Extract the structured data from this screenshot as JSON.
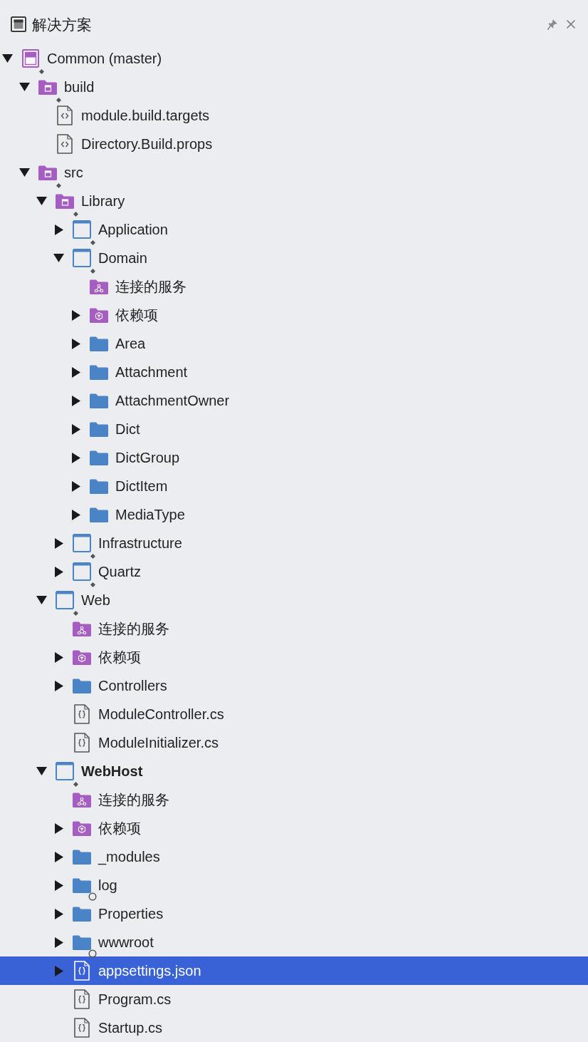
{
  "panel": {
    "title": "解决方案"
  },
  "tree": [
    {
      "label": "Common (master)",
      "kind": "solution",
      "marker": {
        "kind": "diamond"
      },
      "expanded": true,
      "selected": false,
      "children": [
        {
          "label": "build",
          "kind": "solution-folder",
          "marker": {
            "kind": "diamond"
          },
          "expanded": true,
          "selected": false,
          "children": [
            {
              "label": "module.build.targets",
              "kind": "code-file",
              "selected": false
            },
            {
              "label": "Directory.Build.props",
              "kind": "code-file",
              "selected": false
            }
          ]
        },
        {
          "label": "src",
          "kind": "solution-folder",
          "marker": {
            "kind": "diamond"
          },
          "expanded": true,
          "selected": false,
          "children": [
            {
              "label": "Library",
              "kind": "solution-folder",
              "marker": {
                "kind": "diamond"
              },
              "expanded": true,
              "selected": false,
              "children": [
                {
                  "label": "Application",
                  "kind": "project",
                  "marker": {
                    "kind": "diamond"
                  },
                  "expanded": false,
                  "selected": false,
                  "startup": false
                },
                {
                  "label": "Domain",
                  "kind": "project",
                  "marker": {
                    "kind": "diamond"
                  },
                  "expanded": true,
                  "selected": false,
                  "startup": false,
                  "children": [
                    {
                      "label": "连接的服务",
                      "kind": "services",
                      "selected": false
                    },
                    {
                      "label": "依赖项",
                      "kind": "dependencies",
                      "expanded": false,
                      "selected": false
                    },
                    {
                      "label": "Area",
                      "kind": "folder",
                      "expanded": false,
                      "selected": false
                    },
                    {
                      "label": "Attachment",
                      "kind": "folder",
                      "expanded": false,
                      "selected": false
                    },
                    {
                      "label": "AttachmentOwner",
                      "kind": "folder",
                      "expanded": false,
                      "selected": false
                    },
                    {
                      "label": "Dict",
                      "kind": "folder",
                      "expanded": false,
                      "selected": false
                    },
                    {
                      "label": "DictGroup",
                      "kind": "folder",
                      "expanded": false,
                      "selected": false
                    },
                    {
                      "label": "DictItem",
                      "kind": "folder",
                      "expanded": false,
                      "selected": false
                    },
                    {
                      "label": "MediaType",
                      "kind": "folder",
                      "expanded": false,
                      "selected": false
                    }
                  ]
                },
                {
                  "label": "Infrastructure",
                  "kind": "project",
                  "marker": {
                    "kind": "diamond"
                  },
                  "expanded": false,
                  "selected": false,
                  "startup": false
                },
                {
                  "label": "Quartz",
                  "kind": "project",
                  "marker": {
                    "kind": "diamond"
                  },
                  "expanded": false,
                  "selected": false,
                  "startup": false
                }
              ]
            },
            {
              "label": "Web",
              "kind": "project",
              "marker": {
                "kind": "diamond"
              },
              "expanded": true,
              "selected": false,
              "startup": false,
              "children": [
                {
                  "label": "连接的服务",
                  "kind": "services",
                  "selected": false
                },
                {
                  "label": "依赖项",
                  "kind": "dependencies",
                  "expanded": false,
                  "selected": false
                },
                {
                  "label": "Controllers",
                  "kind": "folder",
                  "expanded": false,
                  "selected": false
                },
                {
                  "label": "ModuleController.cs",
                  "kind": "cs-file",
                  "selected": false
                },
                {
                  "label": "ModuleInitializer.cs",
                  "kind": "cs-file",
                  "selected": false
                }
              ]
            },
            {
              "label": "WebHost",
              "kind": "project",
              "marker": {
                "kind": "diamond"
              },
              "expanded": true,
              "selected": false,
              "startup": true,
              "children": [
                {
                  "label": "连接的服务",
                  "kind": "services",
                  "selected": false
                },
                {
                  "label": "依赖项",
                  "kind": "dependencies",
                  "expanded": false,
                  "selected": false
                },
                {
                  "label": "_modules",
                  "kind": "folder",
                  "expanded": false,
                  "selected": false
                },
                {
                  "label": "log",
                  "kind": "folder",
                  "marker": {
                    "kind": "ring"
                  },
                  "expanded": false,
                  "selected": false
                },
                {
                  "label": "Properties",
                  "kind": "folder",
                  "expanded": false,
                  "selected": false
                },
                {
                  "label": "wwwroot",
                  "kind": "folder",
                  "marker": {
                    "kind": "ring"
                  },
                  "expanded": false,
                  "selected": false
                },
                {
                  "label": "appsettings.json",
                  "kind": "cs-file",
                  "expanded": false,
                  "selected": true
                },
                {
                  "label": "Program.cs",
                  "kind": "cs-file",
                  "selected": false
                },
                {
                  "label": "Startup.cs",
                  "kind": "cs-file",
                  "selected": false
                }
              ]
            }
          ]
        }
      ]
    }
  ]
}
